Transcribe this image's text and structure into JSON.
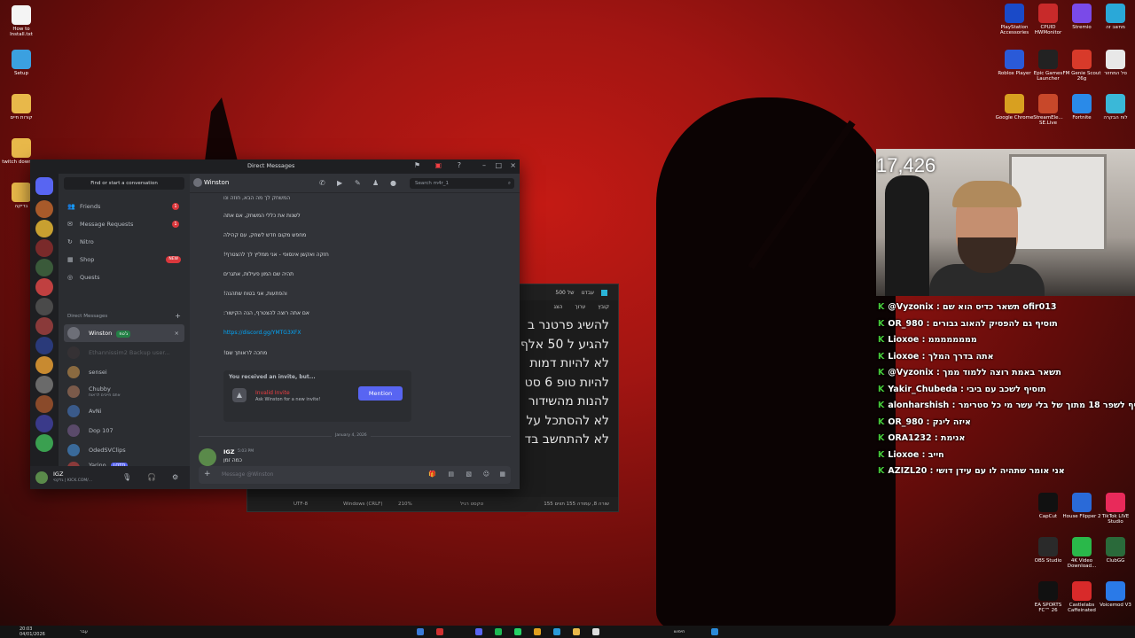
{
  "desktop": {
    "left_icons": [
      "How to Install.txt",
      "Setup",
      "קורות חיים",
      "twitch downlo...",
      "בדיקה"
    ],
    "right_icons": [
      [
        "PlayStation Accessories",
        "CPUID HWMonitor",
        "Stremio",
        "מחשב זה"
      ],
      [
        "Roblox Player",
        "Epic Games Launcher",
        "FM Genie Scout 26g",
        "סל המחזור"
      ],
      [
        "Google Chrome",
        "StreamEle... SE.Live",
        "Fortnite",
        "לוח הבקרה"
      ],
      [
        "CapCut",
        "House Flipper 2",
        "TikTok LIVE Studio"
      ],
      [
        "OBS Studio",
        "4K Video Download...",
        "ClubGG"
      ],
      [
        "EA SPORTS FC™ 26",
        "Castlelabs Caffeinated",
        "Voicemod V3"
      ]
    ]
  },
  "notepad": {
    "tabs": [
      "500 של",
      "עבדנו"
    ],
    "menu": [
      "קובץ",
      "ערוך",
      "הצג"
    ],
    "lines": [
      "להשיג פרטנר ב",
      "להגיע ל 50 אלף",
      "לא להיות דמות",
      "להיות טופ 6 סט",
      "להנות מהשידור",
      "לא להסתכל על",
      "לא להתחשב בד"
    ],
    "status": [
      "שורה 8, עמודה 155",
      "155 תווים",
      "טקסט רגיל",
      "210%",
      "Windows (CRLF)",
      "UTF-8"
    ]
  },
  "discord": {
    "window_title": "Direct Messages",
    "find_placeholder": "Find or start a conversation",
    "nav": [
      {
        "label": "Friends",
        "badge": "1"
      },
      {
        "label": "Message Requests",
        "badge": "1"
      },
      {
        "label": "Nitro",
        "badge": ""
      },
      {
        "label": "Shop",
        "badge": "NEW"
      },
      {
        "label": "Quests",
        "badge": ""
      }
    ],
    "dm_header": "Direct Messages",
    "dms": [
      {
        "name": "Winston",
        "tag": "ג'טפ",
        "sub": "",
        "color": "#6d6f78",
        "active": true
      },
      {
        "name": "Ethannissim2 Backup user...",
        "tag": "",
        "sub": "",
        "color": "#4a3a3a",
        "active": false
      },
      {
        "name": "sensei",
        "tag": "",
        "sub": "",
        "color": "#8a6a40",
        "active": false
      },
      {
        "name": "Chubby",
        "tag": "",
        "sub": "אתם חייבים לראות",
        "color": "#7a5a4a",
        "active": false
      },
      {
        "name": "AvNi",
        "tag": "",
        "sub": "",
        "color": "#3a5a8a",
        "active": false
      },
      {
        "name": "Dop 107",
        "tag": "",
        "sub": "",
        "color": "#5a4a6a",
        "active": false
      },
      {
        "name": "OdedSVClips",
        "tag": "",
        "sub": "",
        "color": "#3a6a9a",
        "active": false
      },
      {
        "name": "Yarino",
        "tag": "LOTD",
        "sub": "ARC Raiders",
        "color": "#8a3a3a",
        "active": false
      }
    ],
    "user": {
      "name": "IGZ",
      "status": "גלקסי | KICK.COM/..."
    },
    "chat_name": "Winston",
    "search_placeholder": "Search m4r_1",
    "messages": [
      "המשחק לך מה הבא, חוזה ונו",
      "לשנות את כללי המשחק, אם אתה",
      "מחפש מקום חדש לשחק, עם קהילה",
      "חזקה ואקשן אינסופי - אני ממליץ לך להצטרף!",
      "תהיה שם המון פעילות, אתגרים",
      "והפתעות, אני בטוח שתהנה!",
      "אם אתה רוצה להצטרף, הנה הקישור:"
    ],
    "link": "https://discord.gg/YMTG3XFX",
    "closing_line": "מחכה לראותך שם!",
    "invite": {
      "header": "You received an invite, but...",
      "title": "Invalid Invite",
      "subtitle": "Ask Winston for a new invite!",
      "button": "Mention"
    },
    "date_divider": "January 4, 2026",
    "last_message": {
      "author": "IGZ",
      "time": "5:03 PM",
      "text": "כמה זמן"
    },
    "composer_placeholder": "Message @Winston"
  },
  "stream": {
    "viewer_count": "17,426",
    "chat": [
      {
        "user": "@Vyzonix",
        "text": ": תשאר כדיס הוא שם ofir013",
        "color": "#ffffff"
      },
      {
        "user": "OR_980",
        "text": ": תוסיף גם להפסיק להאוב גבורים",
        "color": "#ffffff"
      },
      {
        "user": "Lioxoe",
        "text": ": ממממממממ",
        "color": "#ffffff"
      },
      {
        "user": "Lioxoe",
        "text": ": אתה בדרך המלך",
        "color": "#ffffff"
      },
      {
        "user": "@Vyzonix",
        "text": ": תשאר באמת רוצה ללמוד ממך",
        "color": "#ffffff"
      },
      {
        "user": "Yakir_Chubeda",
        "text": ": תוסיף לשכב עם ביבי",
        "color": "#ffffff"
      },
      {
        "user": "alonharshish",
        "text": ": תוסיף לשפר 18 מתוך של בלי עשר מי כל סטרימר",
        "color": "#ffffff"
      },
      {
        "user": "OR_980",
        "text": ": איזה לינק",
        "color": "#ffffff"
      },
      {
        "user": "ORA1232",
        "text": ": אנימת",
        "color": "#ffffff"
      },
      {
        "user": "Lioxoe",
        "text": ": חייב",
        "color": "#ffffff"
      },
      {
        "user": "AZIZL20",
        "text": ": אני אומר שתהיה לו עם עידן דושי",
        "color": "#ffffff"
      }
    ]
  },
  "taskbar": {
    "time": "20:03",
    "date": "04/01/2026",
    "lang": "עבר",
    "search": "חיפוש"
  }
}
